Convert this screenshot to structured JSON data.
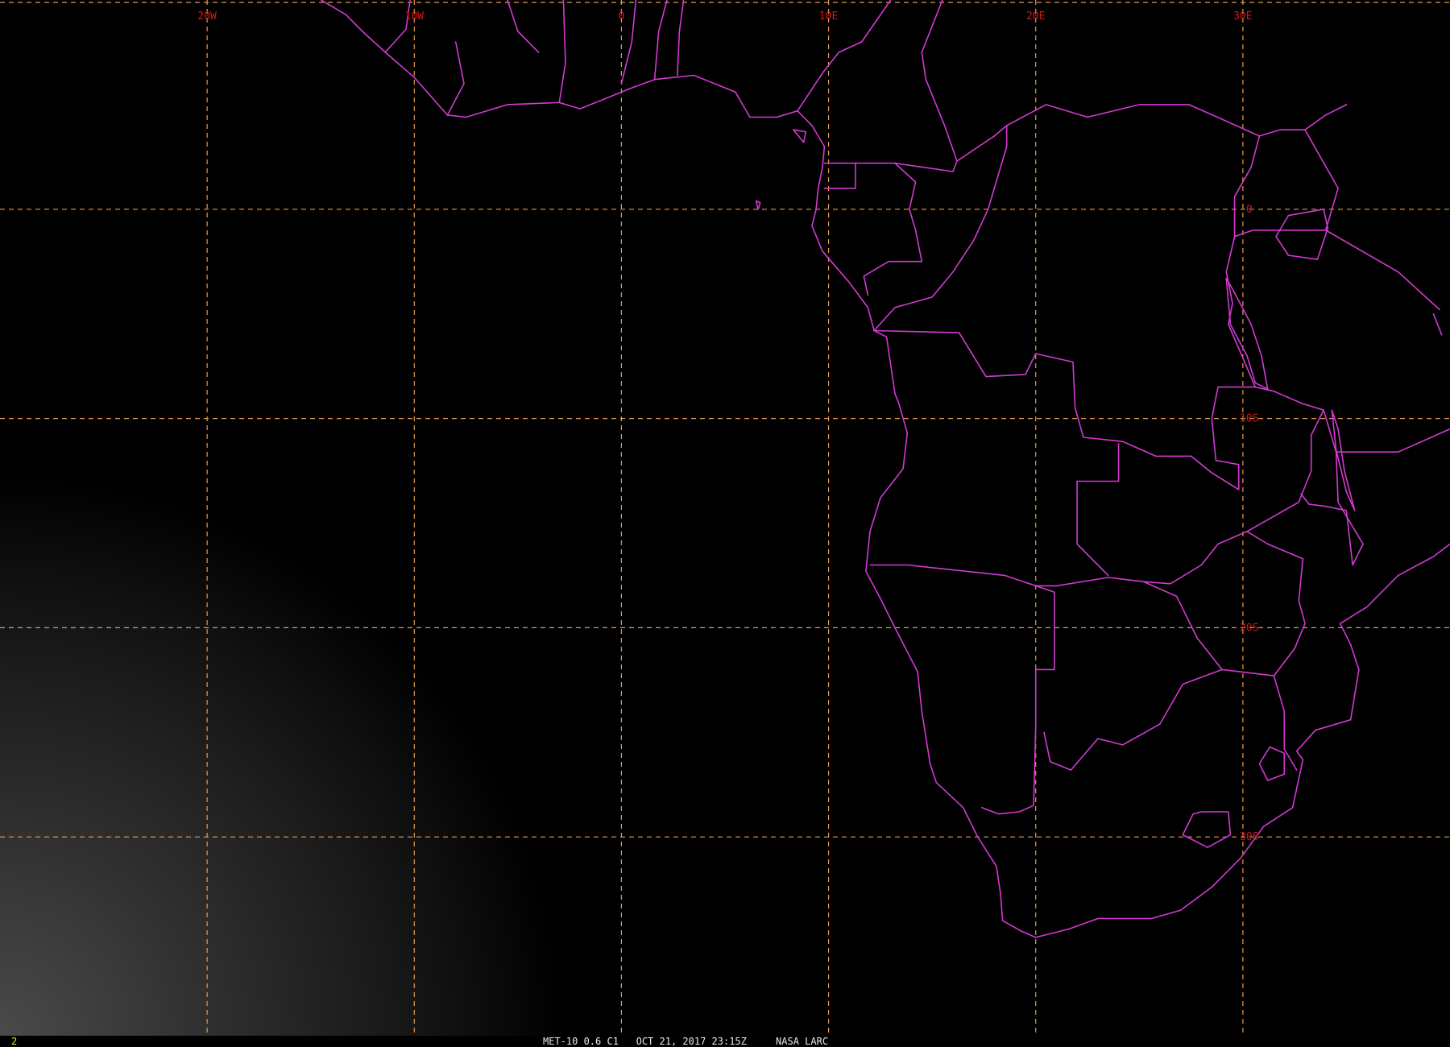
{
  "image": {
    "satellite_channel": "MET-10 0.6 C1",
    "timestamp": "OCT 21, 2017 23:15Z",
    "source": "NASA LARC",
    "frame_number": "2"
  },
  "colors": {
    "background": "#000000",
    "graticule": "#e79a4e",
    "boundaries": "#d23ad2",
    "grid_labels": "#d01818",
    "frame_number": "#e6e01e",
    "caption": "#e8e8e8"
  },
  "map": {
    "projection": "equirectangular",
    "lon_range": [
      -30,
      40
    ],
    "lat_range": [
      10,
      -39.5
    ],
    "graticule_spacing_deg": 10,
    "meridians": [
      {
        "lon": -20,
        "label": "20W"
      },
      {
        "lon": -10,
        "label": "10W"
      },
      {
        "lon": 0,
        "label": "0"
      },
      {
        "lon": 10,
        "label": "10E"
      },
      {
        "lon": 20,
        "label": "20E"
      },
      {
        "lon": 30,
        "label": "30E"
      }
    ],
    "parallels": [
      {
        "lat": 0,
        "label": "0"
      },
      {
        "lat": -10,
        "label": "10S"
      },
      {
        "lat": -20,
        "label": "20S"
      },
      {
        "lat": -30,
        "label": "30S"
      }
    ]
  },
  "boundaries": {
    "coastline": [
      [
        -14.5,
        10.0
      ],
      [
        -13.3,
        9.3
      ],
      [
        -12.5,
        8.5
      ],
      [
        -11.4,
        7.5
      ],
      [
        -10.0,
        6.3
      ],
      [
        -8.4,
        4.5
      ],
      [
        -7.5,
        4.4
      ],
      [
        -5.5,
        5.0
      ],
      [
        -3.0,
        5.1
      ],
      [
        -2.0,
        4.8
      ],
      [
        0.5,
        5.8
      ],
      [
        1.6,
        6.2
      ],
      [
        3.5,
        6.4
      ],
      [
        5.5,
        5.6
      ],
      [
        6.2,
        4.4
      ],
      [
        7.5,
        4.4
      ],
      [
        8.5,
        4.7
      ],
      [
        9.2,
        4.0
      ],
      [
        9.8,
        3.0
      ],
      [
        9.7,
        2.0
      ],
      [
        9.5,
        1.0
      ],
      [
        9.4,
        0.0
      ],
      [
        9.2,
        -0.8
      ],
      [
        9.7,
        -2.0
      ],
      [
        11.0,
        -3.5
      ],
      [
        11.9,
        -4.7
      ],
      [
        12.2,
        -5.8
      ],
      [
        12.8,
        -6.1
      ],
      [
        13.2,
        -8.8
      ],
      [
        13.4,
        -9.3
      ],
      [
        13.8,
        -10.7
      ],
      [
        13.6,
        -12.4
      ],
      [
        12.5,
        -13.8
      ],
      [
        12.0,
        -15.4
      ],
      [
        11.8,
        -17.3
      ],
      [
        12.5,
        -18.6
      ],
      [
        13.2,
        -20.0
      ],
      [
        14.3,
        -22.1
      ],
      [
        14.5,
        -24.0
      ],
      [
        14.9,
        -26.5
      ],
      [
        15.2,
        -27.4
      ],
      [
        16.5,
        -28.6
      ],
      [
        17.2,
        -30.0
      ],
      [
        18.1,
        -31.4
      ],
      [
        18.3,
        -32.7
      ],
      [
        18.4,
        -34.0
      ],
      [
        19.3,
        -34.5
      ],
      [
        20.0,
        -34.8
      ],
      [
        21.6,
        -34.4
      ],
      [
        23.0,
        -33.9
      ],
      [
        25.6,
        -33.9
      ],
      [
        27.0,
        -33.5
      ],
      [
        28.5,
        -32.4
      ],
      [
        29.9,
        -31.0
      ],
      [
        31.0,
        -29.5
      ],
      [
        32.4,
        -28.6
      ],
      [
        32.9,
        -26.3
      ],
      [
        32.6,
        -25.9
      ],
      [
        33.5,
        -24.9
      ],
      [
        35.2,
        -24.4
      ],
      [
        35.6,
        -22.0
      ],
      [
        35.2,
        -20.8
      ],
      [
        34.7,
        -19.8
      ],
      [
        36.0,
        -19.0
      ],
      [
        37.5,
        -17.5
      ],
      [
        39.2,
        -16.6
      ],
      [
        40.0,
        -16.0
      ]
    ],
    "country_borders": [
      [
        [
          0.0,
          6.0
        ],
        [
          0.5,
          8.0
        ],
        [
          0.7,
          10.0
        ]
      ],
      [
        [
          -3.0,
          5.1
        ],
        [
          -2.7,
          7.0
        ],
        [
          -2.8,
          10.0
        ]
      ],
      [
        [
          -8.4,
          4.5
        ],
        [
          -7.6,
          6.0
        ],
        [
          -8.0,
          8.0
        ]
      ],
      [
        [
          -11.4,
          7.5
        ],
        [
          -10.4,
          8.6
        ],
        [
          -10.2,
          10.0
        ]
      ],
      [
        [
          -5.5,
          10.0
        ],
        [
          -5.0,
          8.5
        ],
        [
          -4.0,
          7.5
        ]
      ],
      [
        [
          1.6,
          6.2
        ],
        [
          1.8,
          8.5
        ],
        [
          2.2,
          10.0
        ]
      ],
      [
        [
          2.7,
          6.4
        ],
        [
          2.8,
          8.5
        ],
        [
          3.0,
          10.0
        ]
      ],
      [
        [
          8.5,
          4.7
        ],
        [
          9.7,
          6.5
        ],
        [
          10.5,
          7.5
        ],
        [
          11.6,
          8.0
        ],
        [
          13.0,
          10.0
        ]
      ],
      [
        [
          15.5,
          10.0
        ],
        [
          14.5,
          7.5
        ],
        [
          14.7,
          6.2
        ],
        [
          15.6,
          4.0
        ],
        [
          16.2,
          2.3
        ],
        [
          16.0,
          1.8
        ],
        [
          13.2,
          2.2
        ],
        [
          11.3,
          2.2
        ],
        [
          9.8,
          2.2
        ]
      ],
      [
        [
          11.3,
          2.2
        ],
        [
          11.3,
          1.0
        ],
        [
          9.8,
          1.0
        ]
      ],
      [
        [
          13.2,
          2.2
        ],
        [
          14.2,
          1.3
        ],
        [
          13.9,
          0.0
        ],
        [
          14.2,
          -1.0
        ],
        [
          14.5,
          -2.5
        ],
        [
          12.9,
          -2.5
        ],
        [
          11.7,
          -3.2
        ],
        [
          11.9,
          -4.1
        ]
      ],
      [
        [
          16.2,
          2.3
        ],
        [
          18.0,
          3.5
        ],
        [
          18.6,
          4.0
        ],
        [
          18.6,
          3.0
        ],
        [
          17.7,
          0.0
        ],
        [
          17.0,
          -1.5
        ],
        [
          16.0,
          -3.0
        ],
        [
          15.0,
          -4.2
        ],
        [
          13.2,
          -4.7
        ],
        [
          12.2,
          -5.8
        ]
      ],
      [
        [
          18.6,
          4.0
        ],
        [
          20.5,
          5.0
        ],
        [
          22.5,
          4.4
        ],
        [
          25.0,
          5.0
        ],
        [
          27.4,
          5.0
        ],
        [
          29.0,
          4.3
        ],
        [
          30.8,
          3.5
        ],
        [
          30.4,
          2.0
        ],
        [
          29.6,
          0.6
        ],
        [
          29.6,
          -1.3
        ],
        [
          29.2,
          -3.0
        ],
        [
          29.5,
          -4.5
        ],
        [
          29.3,
          -5.5
        ],
        [
          30.6,
          -8.5
        ],
        [
          28.8,
          -8.5
        ],
        [
          28.5,
          -10.0
        ],
        [
          28.7,
          -12.0
        ],
        [
          29.8,
          -12.2
        ],
        [
          29.8,
          -13.4
        ],
        [
          28.5,
          -12.6
        ],
        [
          27.5,
          -11.8
        ],
        [
          25.8,
          -11.8
        ],
        [
          24.2,
          -11.1
        ],
        [
          22.3,
          -10.9
        ],
        [
          21.9,
          -9.5
        ],
        [
          21.8,
          -7.3
        ],
        [
          20.0,
          -6.9
        ],
        [
          19.5,
          -7.9
        ],
        [
          17.6,
          -8.0
        ],
        [
          16.3,
          -5.9
        ],
        [
          12.2,
          -5.8
        ]
      ],
      [
        [
          30.8,
          3.5
        ],
        [
          31.8,
          3.8
        ],
        [
          33.0,
          3.8
        ],
        [
          34.0,
          4.5
        ],
        [
          35.0,
          5.0
        ]
      ],
      [
        [
          33.0,
          3.8
        ],
        [
          34.6,
          1.0
        ],
        [
          34.0,
          -1.0
        ],
        [
          30.5,
          -1.0
        ],
        [
          29.6,
          -1.3
        ]
      ],
      [
        [
          34.0,
          -1.0
        ],
        [
          37.5,
          -3.0
        ],
        [
          39.5,
          -4.8
        ]
      ],
      [
        [
          30.6,
          -8.5
        ],
        [
          31.5,
          -8.7
        ],
        [
          32.9,
          -9.3
        ],
        [
          33.9,
          -9.6
        ],
        [
          34.5,
          -11.6
        ],
        [
          37.5,
          -11.6
        ],
        [
          40.0,
          -10.5
        ]
      ],
      [
        [
          33.9,
          -9.6
        ],
        [
          33.3,
          -10.8
        ],
        [
          33.3,
          -12.5
        ],
        [
          32.7,
          -14.0
        ],
        [
          30.2,
          -15.4
        ]
      ],
      [
        [
          34.5,
          -11.6
        ],
        [
          34.6,
          -14.0
        ],
        [
          35.8,
          -16.0
        ],
        [
          35.3,
          -17.0
        ],
        [
          35.0,
          -14.4
        ],
        [
          34.0,
          -14.2
        ],
        [
          33.2,
          -14.1
        ],
        [
          32.8,
          -13.6
        ]
      ],
      [
        [
          30.2,
          -15.4
        ],
        [
          28.8,
          -16.0
        ],
        [
          28.0,
          -17.0
        ],
        [
          26.5,
          -17.9
        ],
        [
          25.2,
          -17.8
        ],
        [
          23.5,
          -17.6
        ],
        [
          21.0,
          -18.0
        ],
        [
          20.0,
          -18.0
        ],
        [
          18.5,
          -17.5
        ],
        [
          13.8,
          -17.0
        ],
        [
          12.0,
          -17.0
        ]
      ],
      [
        [
          22.0,
          -13.0
        ],
        [
          22.0,
          -16.0
        ],
        [
          23.5,
          -17.5
        ]
      ],
      [
        [
          22.0,
          -13.0
        ],
        [
          24.0,
          -13.0
        ],
        [
          24.0,
          -11.2
        ]
      ],
      [
        [
          20.0,
          -18.0
        ],
        [
          20.9,
          -18.3
        ],
        [
          20.9,
          -22.0
        ],
        [
          20.0,
          -22.0
        ],
        [
          20.0,
          -24.8
        ],
        [
          19.9,
          -28.5
        ],
        [
          19.2,
          -28.8
        ],
        [
          18.2,
          -28.9
        ],
        [
          17.4,
          -28.6
        ]
      ],
      [
        [
          25.2,
          -17.8
        ],
        [
          26.8,
          -18.5
        ],
        [
          27.8,
          -20.5
        ],
        [
          29.0,
          -22.0
        ],
        [
          31.5,
          -22.3
        ]
      ],
      [
        [
          30.2,
          -15.4
        ],
        [
          31.2,
          -16.0
        ],
        [
          32.9,
          -16.7
        ],
        [
          32.7,
          -18.7
        ],
        [
          33.0,
          -19.8
        ],
        [
          32.5,
          -21.0
        ],
        [
          31.5,
          -22.3
        ]
      ],
      [
        [
          29.0,
          -22.0
        ],
        [
          27.1,
          -22.7
        ],
        [
          26.0,
          -24.6
        ],
        [
          24.2,
          -25.6
        ],
        [
          23.0,
          -25.3
        ],
        [
          21.7,
          -26.8
        ],
        [
          20.7,
          -26.4
        ],
        [
          20.4,
          -25.0
        ]
      ],
      [
        [
          31.5,
          -22.3
        ],
        [
          32.0,
          -24.0
        ],
        [
          32.0,
          -25.8
        ],
        [
          32.6,
          -26.8
        ]
      ],
      [
        [
          31.3,
          -25.7
        ],
        [
          32.0,
          -26.0
        ],
        [
          32.0,
          -27.0
        ],
        [
          31.2,
          -27.3
        ],
        [
          30.8,
          -26.5
        ],
        [
          31.3,
          -25.7
        ]
      ],
      [
        [
          28.0,
          -28.8
        ],
        [
          29.3,
          -28.8
        ],
        [
          29.4,
          -29.9
        ],
        [
          28.3,
          -30.5
        ],
        [
          27.1,
          -29.9
        ],
        [
          27.6,
          -28.9
        ],
        [
          28.0,
          -28.8
        ]
      ]
    ],
    "lakes": [
      [
        [
          32.2,
          -0.3
        ],
        [
          33.9,
          0.0
        ],
        [
          34.1,
          -0.9
        ],
        [
          33.6,
          -2.4
        ],
        [
          32.2,
          -2.2
        ],
        [
          31.6,
          -1.3
        ],
        [
          32.2,
          -0.3
        ]
      ],
      [
        [
          29.2,
          -3.3
        ],
        [
          29.4,
          -5.5
        ],
        [
          30.2,
          -7.0
        ],
        [
          30.6,
          -8.3
        ],
        [
          31.2,
          -8.6
        ],
        [
          30.9,
          -7.0
        ],
        [
          30.4,
          -5.5
        ],
        [
          29.6,
          -4.0
        ],
        [
          29.2,
          -3.3
        ]
      ],
      [
        [
          34.3,
          -9.6
        ],
        [
          34.5,
          -11.5
        ],
        [
          35.0,
          -13.5
        ],
        [
          35.4,
          -14.4
        ],
        [
          34.9,
          -12.5
        ],
        [
          34.6,
          -10.5
        ],
        [
          34.3,
          -9.6
        ]
      ]
    ],
    "islands": [
      [
        [
          8.3,
          3.8
        ],
        [
          8.9,
          3.7
        ],
        [
          8.8,
          3.2
        ],
        [
          8.3,
          3.8
        ]
      ],
      [
        [
          6.5,
          0.4
        ],
        [
          6.7,
          0.3
        ],
        [
          6.6,
          0.0
        ],
        [
          6.5,
          0.4
        ]
      ],
      [
        [
          39.2,
          -5.0
        ],
        [
          39.6,
          -6.0
        ]
      ]
    ]
  }
}
